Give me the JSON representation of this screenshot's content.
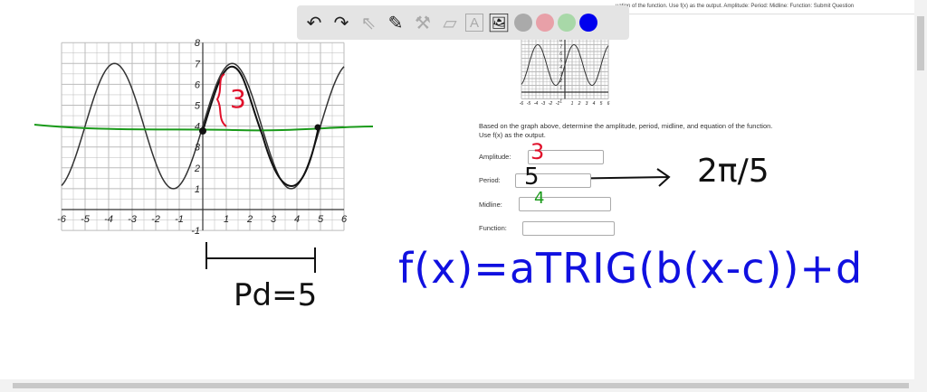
{
  "header": {
    "question_strip": "uation of the function. Use f(x) as the output. Amplitude: Period: Midline: Function: Submit Question"
  },
  "toolbar": {
    "tools": [
      "undo-icon",
      "redo-icon",
      "pointer-icon",
      "pen-icon",
      "tools-icon",
      "eraser-icon",
      "text-icon",
      "image-icon"
    ],
    "colors": [
      "#aaaaaa",
      "#e8a0a8",
      "#a8d8a8",
      "#0000ee"
    ]
  },
  "question": {
    "line1": "Based on the graph above, determine the amplitude, period, midline, and equation of the function.",
    "line2": "Use f(x) as the output.",
    "amplitude_label": "Amplitude:",
    "period_label": "Period:",
    "midline_label": "Midline:",
    "function_label": "Function:",
    "amplitude_value": "",
    "period_value": "",
    "midline_value": "",
    "function_value": ""
  },
  "graph": {
    "x_ticks": [
      "-6",
      "-5",
      "-4",
      "-3",
      "-2",
      "-1",
      "1",
      "2",
      "3",
      "4",
      "5",
      "6"
    ],
    "y_ticks": [
      "8",
      "7",
      "6",
      "5",
      "4",
      "3",
      "2",
      "1",
      "-1"
    ]
  },
  "annotations": {
    "amplitude": "3",
    "period": "5",
    "midline": "4",
    "b_value": "2π/5",
    "brace_label": "3",
    "period_label": "Pd=5",
    "formula": "f(x)=aTRIG(b(x-c))+d",
    "colors": {
      "red": "#e0102a",
      "green": "#1a9a1a",
      "blue": "#1010e0",
      "black": "#111111"
    }
  }
}
